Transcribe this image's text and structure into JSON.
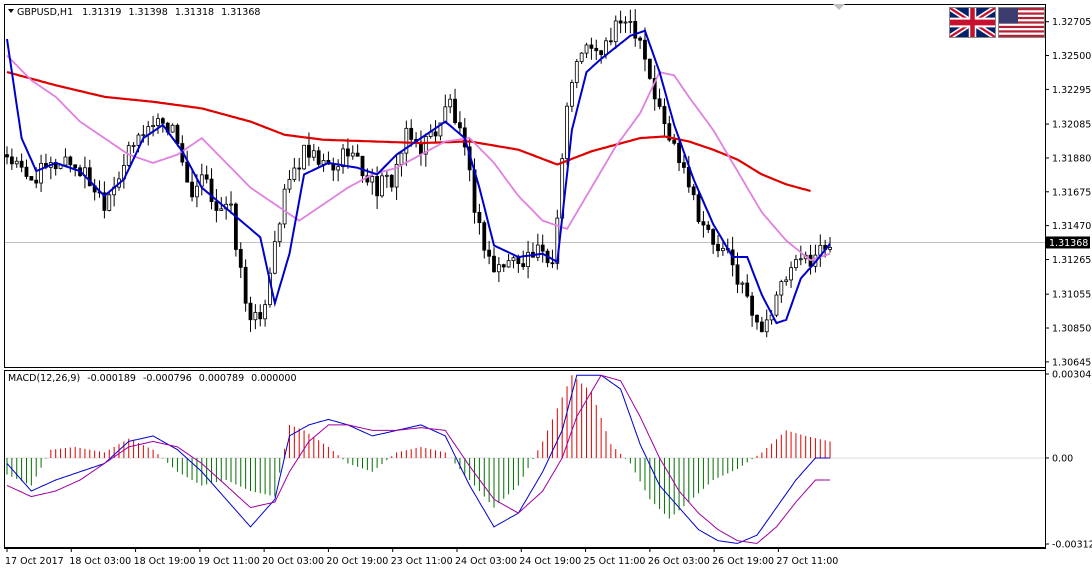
{
  "header": {
    "symbol_timeframe": "GBPUSD,H1",
    "ohlc": [
      "1.31319",
      "1.31398",
      "1.31318",
      "1.31368"
    ]
  },
  "flags": [
    {
      "name": "uk-flag-icon",
      "label": "GBP"
    },
    {
      "name": "us-flag-icon",
      "label": "USD"
    }
  ],
  "colors": {
    "bull_candle": "#000000",
    "bear_candle": "#000000",
    "ma_fast": "#0000cc",
    "ma_mid": "#e080e0",
    "ma_slow": "#e00000",
    "macd_hist_up": "#e00000",
    "macd_hist_down": "#007000",
    "macd_line": "#0000cc",
    "signal_line": "#a000a0"
  },
  "chart_data": [
    {
      "type": "candlestick",
      "title": "GBPUSD,H1",
      "y_ticks": [
        "1.32705",
        "1.32500",
        "1.32295",
        "1.32085",
        "1.31880",
        "1.31675",
        "1.31470",
        "1.31265",
        "1.31055",
        "1.30850",
        "1.30645"
      ],
      "ylim": [
        1.3062,
        1.328
      ],
      "current_price": "1.31368",
      "x_tick_labels": [
        "17 Oct 2017",
        "18 Oct 03:00",
        "18 Oct 19:00",
        "19 Oct 11:00",
        "20 Oct 03:00",
        "20 Oct 19:00",
        "23 Oct 11:00",
        "24 Oct 03:00",
        "24 Oct 19:00",
        "25 Oct 11:00",
        "26 Oct 03:00",
        "26 Oct 19:00",
        "27 Oct 11:00"
      ],
      "close_path": [
        [
          0,
          1.319
        ],
        [
          4,
          1.3175
        ],
        [
          8,
          1.318
        ],
        [
          12,
          1.3188
        ],
        [
          16,
          1.3178
        ],
        [
          20,
          1.3162
        ],
        [
          24,
          1.3185
        ],
        [
          28,
          1.3205
        ],
        [
          32,
          1.3212
        ],
        [
          35,
          1.32
        ],
        [
          38,
          1.316
        ],
        [
          40,
          1.3175
        ],
        [
          43,
          1.316
        ],
        [
          46,
          1.3155
        ],
        [
          49,
          1.31
        ],
        [
          52,
          1.3085
        ],
        [
          55,
          1.314
        ],
        [
          58,
          1.3175
        ],
        [
          61,
          1.319
        ],
        [
          64,
          1.3185
        ],
        [
          67,
          1.318
        ],
        [
          70,
          1.3195
        ],
        [
          73,
          1.318
        ],
        [
          76,
          1.317
        ],
        [
          79,
          1.3175
        ],
        [
          82,
          1.32
        ],
        [
          85,
          1.3195
        ],
        [
          88,
          1.3205
        ],
        [
          91,
          1.3222
        ],
        [
          94,
          1.319
        ],
        [
          97,
          1.3145
        ],
        [
          100,
          1.312
        ],
        [
          103,
          1.3125
        ],
        [
          106,
          1.3128
        ],
        [
          109,
          1.313
        ],
        [
          112,
          1.3125
        ],
        [
          115,
          1.322
        ],
        [
          118,
          1.3255
        ],
        [
          121,
          1.325
        ],
        [
          124,
          1.326
        ],
        [
          127,
          1.3275
        ],
        [
          130,
          1.3262
        ],
        [
          133,
          1.3225
        ],
        [
          136,
          1.32
        ],
        [
          139,
          1.3185
        ],
        [
          142,
          1.3155
        ],
        [
          145,
          1.3135
        ],
        [
          148,
          1.3128
        ],
        [
          151,
          1.311
        ],
        [
          154,
          1.3085
        ],
        [
          157,
          1.3095
        ],
        [
          160,
          1.3115
        ],
        [
          163,
          1.3125
        ],
        [
          166,
          1.313
        ],
        [
          169,
          1.3137
        ]
      ],
      "ma_fast_path": [
        [
          0,
          1.326
        ],
        [
          3,
          1.32
        ],
        [
          6,
          1.318
        ],
        [
          10,
          1.3185
        ],
        [
          15,
          1.318
        ],
        [
          20,
          1.3165
        ],
        [
          24,
          1.3175
        ],
        [
          28,
          1.32
        ],
        [
          32,
          1.3208
        ],
        [
          36,
          1.3192
        ],
        [
          40,
          1.317
        ],
        [
          44,
          1.316
        ],
        [
          48,
          1.315
        ],
        [
          52,
          1.314
        ],
        [
          55,
          1.31
        ],
        [
          58,
          1.313
        ],
        [
          61,
          1.3178
        ],
        [
          66,
          1.3185
        ],
        [
          72,
          1.3182
        ],
        [
          76,
          1.3178
        ],
        [
          80,
          1.319
        ],
        [
          85,
          1.32
        ],
        [
          90,
          1.321
        ],
        [
          94,
          1.32
        ],
        [
          97,
          1.317
        ],
        [
          100,
          1.3135
        ],
        [
          105,
          1.3128
        ],
        [
          110,
          1.313
        ],
        [
          113,
          1.3125
        ],
        [
          116,
          1.3205
        ],
        [
          119,
          1.324
        ],
        [
          122,
          1.3248
        ],
        [
          125,
          1.3255
        ],
        [
          128,
          1.3262
        ],
        [
          131,
          1.3265
        ],
        [
          134,
          1.324
        ],
        [
          137,
          1.3208
        ],
        [
          141,
          1.3175
        ],
        [
          145,
          1.3148
        ],
        [
          149,
          1.3128
        ],
        [
          152,
          1.3128
        ],
        [
          155,
          1.3105
        ],
        [
          158,
          1.3088
        ],
        [
          160,
          1.309
        ],
        [
          163,
          1.3115
        ],
        [
          166,
          1.3125
        ],
        [
          169,
          1.3136
        ]
      ],
      "ma_mid_path": [
        [
          0,
          1.325
        ],
        [
          5,
          1.3235
        ],
        [
          10,
          1.3225
        ],
        [
          15,
          1.321
        ],
        [
          20,
          1.32
        ],
        [
          25,
          1.319
        ],
        [
          30,
          1.3185
        ],
        [
          35,
          1.319
        ],
        [
          40,
          1.32
        ],
        [
          45,
          1.3185
        ],
        [
          50,
          1.317
        ],
        [
          55,
          1.316
        ],
        [
          60,
          1.315
        ],
        [
          65,
          1.316
        ],
        [
          70,
          1.317
        ],
        [
          75,
          1.3178
        ],
        [
          80,
          1.3182
        ],
        [
          85,
          1.319
        ],
        [
          90,
          1.3198
        ],
        [
          95,
          1.32
        ],
        [
          100,
          1.3185
        ],
        [
          105,
          1.3165
        ],
        [
          110,
          1.315
        ],
        [
          115,
          1.3145
        ],
        [
          120,
          1.317
        ],
        [
          125,
          1.3195
        ],
        [
          130,
          1.3215
        ],
        [
          134,
          1.324
        ],
        [
          137,
          1.3238
        ],
        [
          140,
          1.3225
        ],
        [
          145,
          1.3205
        ],
        [
          150,
          1.318
        ],
        [
          155,
          1.3155
        ],
        [
          160,
          1.3138
        ],
        [
          165,
          1.3126
        ],
        [
          169,
          1.313
        ]
      ],
      "ma_slow_path": [
        [
          0,
          1.324
        ],
        [
          10,
          1.3232
        ],
        [
          20,
          1.3225
        ],
        [
          30,
          1.3222
        ],
        [
          40,
          1.3218
        ],
        [
          50,
          1.321
        ],
        [
          57,
          1.3202
        ],
        [
          65,
          1.3199
        ],
        [
          75,
          1.3198
        ],
        [
          85,
          1.3197
        ],
        [
          95,
          1.3198
        ],
        [
          105,
          1.3193
        ],
        [
          113,
          1.3184
        ],
        [
          120,
          1.3192
        ],
        [
          130,
          1.32
        ],
        [
          135,
          1.3201
        ],
        [
          140,
          1.3198
        ],
        [
          145,
          1.3193
        ],
        [
          150,
          1.3187
        ],
        [
          155,
          1.3178
        ],
        [
          160,
          1.3172
        ],
        [
          165,
          1.3168
        ]
      ]
    },
    {
      "type": "bar",
      "title": "MACD(12,26,9)",
      "values_text": [
        "-0.000189",
        "-0.000796",
        "0.000789",
        "0.000000"
      ],
      "y_ticks": [
        "0.003046",
        "0.00",
        "-0.003121"
      ],
      "ylim": [
        -0.003121,
        0.003046
      ],
      "histogram_path": [
        [
          0,
          -0.0006
        ],
        [
          5,
          -0.001
        ],
        [
          9,
          0.0003
        ],
        [
          14,
          0.0004
        ],
        [
          20,
          0.0002
        ],
        [
          25,
          0.0007
        ],
        [
          30,
          0.0003
        ],
        [
          35,
          -0.0005
        ],
        [
          40,
          -0.001
        ],
        [
          45,
          -0.0008
        ],
        [
          50,
          -0.0012
        ],
        [
          55,
          -0.0014
        ],
        [
          58,
          0.0012
        ],
        [
          61,
          0.001
        ],
        [
          66,
          0.0004
        ],
        [
          70,
          -0.0002
        ],
        [
          75,
          -0.0005
        ],
        [
          80,
          0.0002
        ],
        [
          85,
          0.0004
        ],
        [
          90,
          0.0002
        ],
        [
          95,
          -0.0008
        ],
        [
          100,
          -0.0018
        ],
        [
          105,
          -0.001
        ],
        [
          110,
          0.0006
        ],
        [
          113,
          0.0018
        ],
        [
          116,
          0.003
        ],
        [
          120,
          0.0024
        ],
        [
          124,
          0.0005
        ],
        [
          128,
          -0.0002
        ],
        [
          132,
          -0.0015
        ],
        [
          136,
          -0.0022
        ],
        [
          140,
          -0.0016
        ],
        [
          145,
          -0.0008
        ],
        [
          150,
          -0.0004
        ],
        [
          155,
          0.0002
        ],
        [
          160,
          0.001
        ],
        [
          164,
          0.0008
        ],
        [
          169,
          0.0006
        ]
      ],
      "macd_path": [
        [
          0,
          -0.0002
        ],
        [
          5,
          -0.0012
        ],
        [
          10,
          -0.0008
        ],
        [
          15,
          -0.0005
        ],
        [
          20,
          -0.0002
        ],
        [
          25,
          0.0006
        ],
        [
          30,
          0.0008
        ],
        [
          35,
          0.0003
        ],
        [
          40,
          -0.0005
        ],
        [
          45,
          -0.0015
        ],
        [
          50,
          -0.0025
        ],
        [
          55,
          -0.0015
        ],
        [
          58,
          0.0008
        ],
        [
          62,
          0.0012
        ],
        [
          66,
          0.0014
        ],
        [
          70,
          0.0012
        ],
        [
          75,
          0.0008
        ],
        [
          80,
          0.001
        ],
        [
          85,
          0.0012
        ],
        [
          90,
          0.0008
        ],
        [
          95,
          -0.001
        ],
        [
          100,
          -0.0025
        ],
        [
          105,
          -0.002
        ],
        [
          110,
          -0.0005
        ],
        [
          114,
          0.001
        ],
        [
          117,
          0.003
        ],
        [
          122,
          0.003
        ],
        [
          126,
          0.0025
        ],
        [
          130,
          0.0005
        ],
        [
          134,
          -0.001
        ],
        [
          138,
          -0.0018
        ],
        [
          142,
          -0.0026
        ],
        [
          146,
          -0.003
        ],
        [
          150,
          -0.0031
        ],
        [
          154,
          -0.0028
        ],
        [
          158,
          -0.0018
        ],
        [
          162,
          -0.0008
        ],
        [
          166,
          0.0
        ],
        [
          169,
          0.0
        ]
      ],
      "signal_path": [
        [
          0,
          -0.001
        ],
        [
          5,
          -0.0014
        ],
        [
          10,
          -0.0012
        ],
        [
          15,
          -0.0008
        ],
        [
          20,
          -0.0002
        ],
        [
          25,
          0.0004
        ],
        [
          30,
          0.0006
        ],
        [
          35,
          0.0004
        ],
        [
          40,
          -0.0002
        ],
        [
          45,
          -0.001
        ],
        [
          50,
          -0.0018
        ],
        [
          55,
          -0.0016
        ],
        [
          58,
          -0.0005
        ],
        [
          62,
          0.0006
        ],
        [
          66,
          0.0012
        ],
        [
          70,
          0.0012
        ],
        [
          75,
          0.001
        ],
        [
          80,
          0.001
        ],
        [
          85,
          0.0011
        ],
        [
          90,
          0.001
        ],
        [
          95,
          -0.0003
        ],
        [
          100,
          -0.0015
        ],
        [
          105,
          -0.002
        ],
        [
          110,
          -0.0012
        ],
        [
          114,
          0.0
        ],
        [
          117,
          0.0015
        ],
        [
          122,
          0.003
        ],
        [
          126,
          0.0028
        ],
        [
          130,
          0.0015
        ],
        [
          134,
          0.0
        ],
        [
          138,
          -0.0012
        ],
        [
          142,
          -0.002
        ],
        [
          146,
          -0.0026
        ],
        [
          150,
          -0.003
        ],
        [
          154,
          -0.0031
        ],
        [
          158,
          -0.0025
        ],
        [
          162,
          -0.0016
        ],
        [
          166,
          -0.0008
        ],
        [
          169,
          -0.0008
        ]
      ]
    }
  ]
}
